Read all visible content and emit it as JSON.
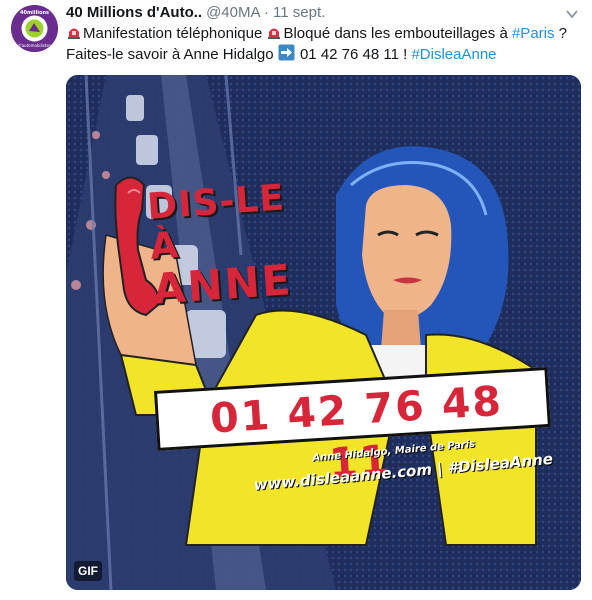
{
  "author": {
    "name": "40 Millions d'Auto..",
    "handle": "@40MA",
    "separator": "·",
    "date": "11 sept.",
    "avatar_text_top": "40millions",
    "avatar_text_bottom": "d'automobilistes",
    "avatar_color": "#6b2c8f"
  },
  "tweet": {
    "line1_part1": "Manifestation téléphonique",
    "line1_part2": "Bloqué dans les embouteillages à",
    "line1_link": "#Paris",
    "line1_end": "?",
    "line2_part1": "Faites-le savoir à Anne Hidalgo",
    "line2_phone": "01 42 76 48 11 !",
    "line2_link": "#DisleaAnne",
    "link_color": "#1b95e0",
    "emoji_siren": "siren-icon",
    "emoji_arrow": "right-arrow-icon"
  },
  "media": {
    "title_line1": "DIS-LE À",
    "title_line2": "ANNE",
    "phone_number": "01 42 76 48 11",
    "caption": "Anne Hidalgo, Maire de Paris",
    "website": "www.disleaanne.com | #DisleaAnne",
    "badge": "GIF",
    "accent_red": "#d7263a",
    "jacket_yellow": "#f2e528",
    "hair_blue": "#2356b8"
  }
}
